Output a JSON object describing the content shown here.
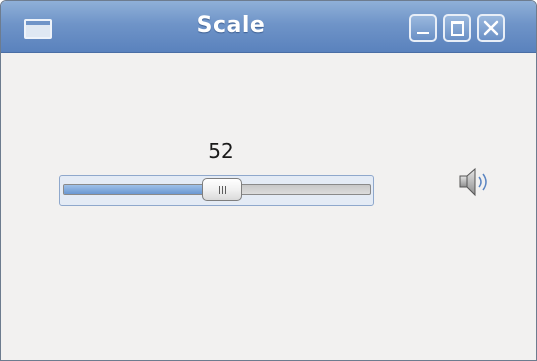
{
  "window": {
    "title": "Scale",
    "icon": "window-icon",
    "buttons": [
      "minimize-icon",
      "maximize-icon",
      "close-icon"
    ]
  },
  "scale": {
    "value": 52,
    "value_text": "52",
    "min": 0,
    "max": 100,
    "fill_color": "#6a98d2"
  },
  "volume_icon": "speaker-icon",
  "colors": {
    "titlebar": "#6f94c8",
    "background": "#f2f1f0"
  }
}
